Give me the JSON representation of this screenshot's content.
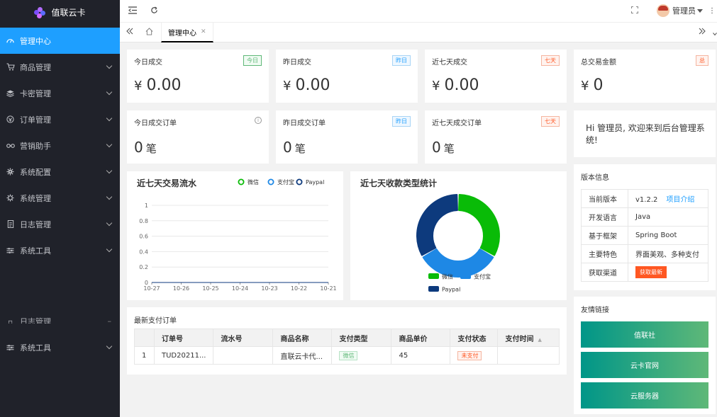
{
  "app": {
    "name": "值联云卡"
  },
  "sidebar": {
    "items": [
      {
        "label": "管理中心",
        "icon": "dashboard-icon"
      },
      {
        "label": "商品管理",
        "icon": "cart-icon"
      },
      {
        "label": "卡密管理",
        "icon": "layers-icon"
      },
      {
        "label": "订单管理",
        "icon": "settings-circle-icon"
      },
      {
        "label": "营销助手",
        "icon": "link-icon"
      },
      {
        "label": "系统配置",
        "icon": "gear-icon"
      },
      {
        "label": "系统管理",
        "icon": "gear-icon"
      },
      {
        "label": "日志管理",
        "icon": "log-icon"
      },
      {
        "label": "系统工具",
        "icon": "sliders-icon"
      }
    ],
    "ghost_items": [
      {
        "label": "日志管理"
      },
      {
        "label": "系统工具"
      }
    ]
  },
  "header": {
    "user": "管理员"
  },
  "tabs": {
    "active": "管理中心"
  },
  "stats": [
    {
      "title": "今日成交",
      "badge": "今日",
      "currency": "¥",
      "value": "0.00"
    },
    {
      "title": "昨日成交",
      "badge": "昨日",
      "currency": "¥",
      "value": "0.00"
    },
    {
      "title": "近七天成交",
      "badge": "七天",
      "currency": "¥",
      "value": "0.00"
    },
    {
      "title": "总交易金额",
      "badge": "总",
      "currency": "¥",
      "value": "0"
    }
  ],
  "orders_stats": [
    {
      "title": "今日成交订单",
      "value": "0",
      "unit": "笔"
    },
    {
      "title": "昨日成交订单",
      "badge": "昨日",
      "value": "0",
      "unit": "笔"
    },
    {
      "title": "近七天成交订单",
      "badge": "七天",
      "value": "0",
      "unit": "笔"
    }
  ],
  "welcome": {
    "text": "Hi 管理员, 欢迎来到后台管理系统!"
  },
  "version": {
    "title": "版本信息",
    "rows": [
      {
        "k": "当前版本",
        "v": "v1.2.2",
        "link": "项目介绍"
      },
      {
        "k": "开发语言",
        "v": "Java"
      },
      {
        "k": "基于框架",
        "v": "Spring Boot"
      },
      {
        "k": "主要特色",
        "v": "界面美观、多种支付"
      },
      {
        "k": "获取渠道",
        "button": "获取最新"
      }
    ]
  },
  "friends": {
    "title": "友情链接",
    "links": [
      "值联社",
      "云卡官网",
      "云服务器"
    ]
  },
  "recent_orders": {
    "title": "最新支付订单",
    "columns": [
      "",
      "订单号",
      "流水号",
      "商品名称",
      "支付类型",
      "商品单价",
      "支付状态",
      "支付时间"
    ],
    "rows": [
      {
        "idx": "1",
        "order_no": "TUD20211...",
        "serial": "",
        "product": "直联云卡代...",
        "pay_type": "微信",
        "price": "45",
        "status": "未支付",
        "time": ""
      }
    ]
  },
  "chart_data": [
    {
      "type": "line",
      "title": "近七天交易流水",
      "x": [
        "10-27",
        "10-26",
        "10-25",
        "10-24",
        "10-23",
        "10-22",
        "10-21"
      ],
      "ylim": [
        0,
        1
      ],
      "yticks": [
        "0",
        "0.2",
        "0.4",
        "0.6",
        "0.8",
        "1"
      ],
      "grid": true,
      "legend": "top-right",
      "series": [
        {
          "name": "微信",
          "color": "#09bb07",
          "values": [
            0,
            0,
            0,
            0,
            0,
            0,
            0
          ]
        },
        {
          "name": "支付宝",
          "color": "#1e88e5",
          "values": [
            0,
            0,
            0,
            0,
            0,
            0,
            0
          ]
        },
        {
          "name": "Paypal",
          "color": "#0d3a7d",
          "values": [
            0,
            0,
            0,
            0,
            0,
            0,
            0
          ]
        }
      ]
    },
    {
      "type": "pie",
      "title": "近七天收款类型统计",
      "legend": "bottom",
      "slices": [
        {
          "name": "微信",
          "color": "#09bb07",
          "value": 1
        },
        {
          "name": "支付宝",
          "color": "#1e88e5",
          "value": 1
        },
        {
          "name": "Paypal",
          "color": "#0d3a7d",
          "value": 1
        }
      ]
    }
  ]
}
